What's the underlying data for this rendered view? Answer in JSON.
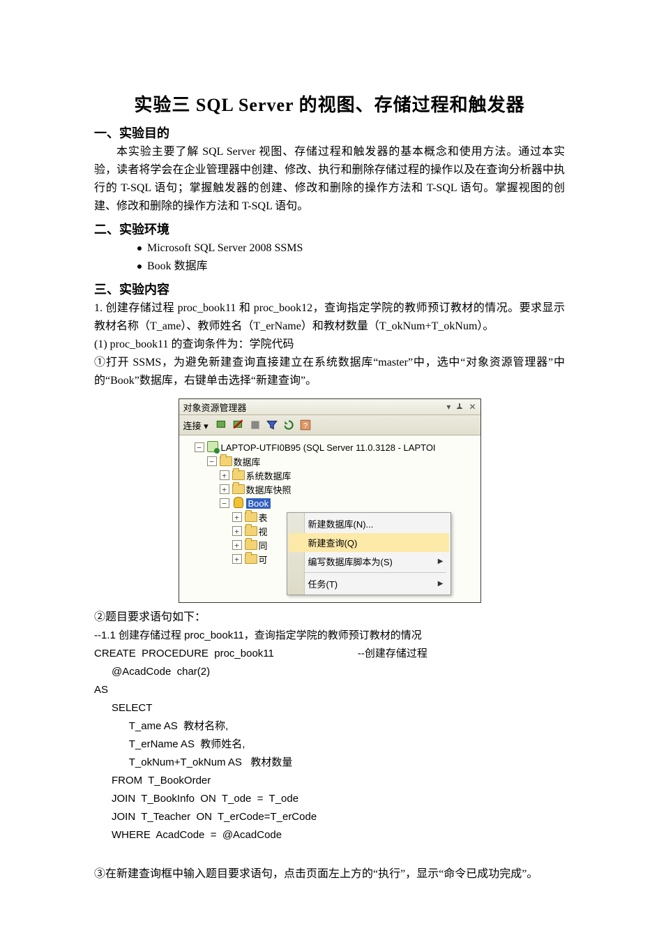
{
  "title": "实验三  SQL Server 的视图、存储过程和触发器",
  "s1_heading": "一、实验目的",
  "s1_para": "本实验主要了解 SQL Server 视图、存储过程和触发器的基本概念和使用方法。通过本实验，读者将学会在企业管理器中创建、修改、执行和删除存储过程的操作以及在查询分析器中执行的 T-SQL 语句；掌握触发器的创建、修改和删除的操作方法和 T-SQL 语句。掌握视图的创建、修改和删除的操作方法和 T-SQL 语句。",
  "s2_heading": "二、实验环境",
  "env_items": [
    "Microsoft SQL Server 2008 SSMS",
    "Book 数据库"
  ],
  "s3_heading": "三、实验内容",
  "s3_p1": "1.  创建存储过程 proc_book11 和 proc_book12，查询指定学院的教师预订教材的情况。要求显示教材名称（T_ame）、教师姓名（T_erName）和教材数量（T_okNum+T_okNum）。",
  "s3_p2": "(1) proc_book11 的查询条件为：学院代码",
  "s3_p3": "①打开 SSMS，为避免新建查询直接建立在系统数据库“master”中，选中“对象资源管理器”中的“Book”数据库，右键单击选择“新建查询”。",
  "shot": {
    "panel_title": "对象资源管理器",
    "toolbar_label": "连接 ▾",
    "server_label": "LAPTOP-UTFI0B95 (SQL Server 11.0.3128 - LAPTOI",
    "node_db": "数据库",
    "node_sysdb": "系统数据库",
    "node_snap": "数据库快照",
    "node_book": "Book",
    "child_a": "表",
    "child_b": "视",
    "child_c": "同",
    "child_d": "可",
    "ctx": {
      "new_db": "新建数据库(N)...",
      "new_query": "新建查询(Q)",
      "script_as": "编写数据库脚本为(S)",
      "tasks": "任务(T)"
    }
  },
  "post1": "②题目要求语句如下：",
  "code": {
    "l1": "--1.1 创建存储过程 proc_book11，查询指定学院的教师预订教材的情况",
    "l2a": "CREATE  PROCEDURE  proc_book11",
    "l2b": "--创建存储过程",
    "l3": "      @AcadCode  char(2)",
    "l4": "AS",
    "l5": "      SELECT",
    "l6": "            T_ame AS  教材名称,",
    "l7": "            T_erName AS  教师姓名,",
    "l8": "            T_okNum+T_okNum AS   教材数量",
    "l9": "      FROM  T_BookOrder",
    "l10": "      JOIN  T_BookInfo  ON  T_ode  =  T_ode",
    "l11": "      JOIN  T_Teacher  ON  T_erCode=T_erCode",
    "l12": "      WHERE  AcadCode  =  @AcadCode"
  },
  "post2": "③在新建查询框中输入题目要求语句，点击页面左上方的“执行”，显示“命令已成功完成”。"
}
